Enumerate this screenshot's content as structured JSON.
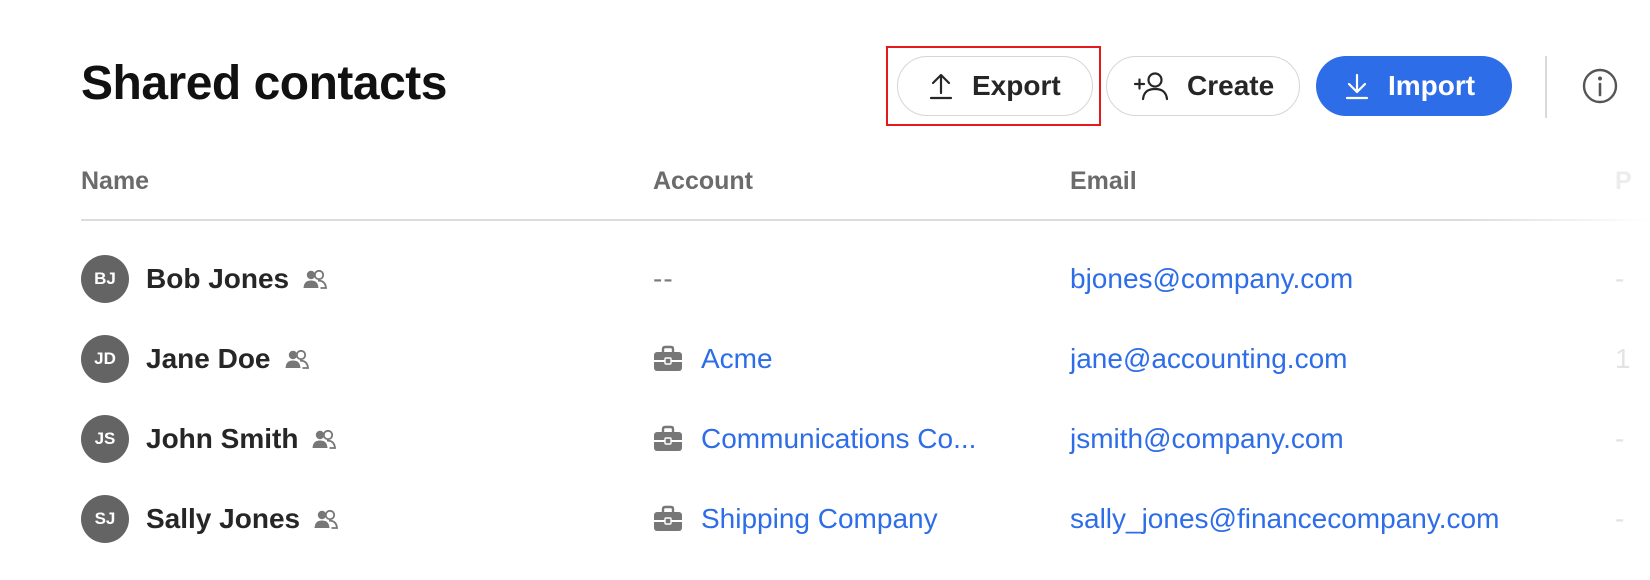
{
  "header": {
    "title": "Shared contacts",
    "export_label": "Export",
    "create_label": "Create",
    "import_label": "Import"
  },
  "columns": {
    "name": "Name",
    "account": "Account",
    "email": "Email",
    "phone": "P"
  },
  "contacts": [
    {
      "initials": "BJ",
      "name": "Bob Jones",
      "account": "--",
      "email": "bjones@company.com",
      "phone": "-"
    },
    {
      "initials": "JD",
      "name": "Jane Doe",
      "account": "Acme",
      "email": "jane@accounting.com",
      "phone": "1"
    },
    {
      "initials": "JS",
      "name": "John Smith",
      "account": "Communications Co...",
      "email": "jsmith@company.com",
      "phone": "-"
    },
    {
      "initials": "SJ",
      "name": "Sally Jones",
      "account": "Shipping Company",
      "email": "sally_jones@financecompany.com",
      "phone": "-"
    }
  ],
  "icons": {
    "export": "upload-icon",
    "create": "add-person-icon",
    "import": "download-icon",
    "info": "info-icon",
    "shared": "people-icon",
    "account": "briefcase-icon"
  },
  "colors": {
    "accent": "#2e6de8",
    "avatar": "#646464",
    "highlight": "#e3191b"
  }
}
